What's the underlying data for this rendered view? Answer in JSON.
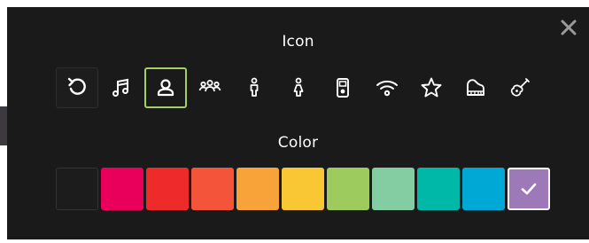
{
  "dialog": {
    "icon_title": "Icon",
    "color_title": "Color",
    "close_icon": "close-icon"
  },
  "icons": [
    {
      "name": "reset-icon",
      "state": "reset"
    },
    {
      "name": "music-note-icon",
      "state": "normal"
    },
    {
      "name": "person-icon",
      "state": "selected"
    },
    {
      "name": "group-icon",
      "state": "normal"
    },
    {
      "name": "man-icon",
      "state": "normal"
    },
    {
      "name": "woman-icon",
      "state": "normal"
    },
    {
      "name": "ipod-icon",
      "state": "normal"
    },
    {
      "name": "wifi-icon",
      "state": "normal"
    },
    {
      "name": "star-icon",
      "state": "normal"
    },
    {
      "name": "piano-icon",
      "state": "normal"
    },
    {
      "name": "guitar-icon",
      "state": "normal"
    }
  ],
  "colors": [
    {
      "name": "color-none",
      "hex": "#1c1c1c",
      "selected": false
    },
    {
      "name": "color-pink",
      "hex": "#e8005b",
      "selected": false
    },
    {
      "name": "color-red",
      "hex": "#ef2a2a",
      "selected": false
    },
    {
      "name": "color-orange-red",
      "hex": "#f4553a",
      "selected": false
    },
    {
      "name": "color-orange",
      "hex": "#f8a23a",
      "selected": false
    },
    {
      "name": "color-yellow",
      "hex": "#f9c733",
      "selected": false
    },
    {
      "name": "color-green",
      "hex": "#9ecb5d",
      "selected": false
    },
    {
      "name": "color-mint",
      "hex": "#84cca2",
      "selected": false
    },
    {
      "name": "color-teal",
      "hex": "#00b8a7",
      "selected": false
    },
    {
      "name": "color-blue",
      "hex": "#00a8d6",
      "selected": false
    },
    {
      "name": "color-purple",
      "hex": "#9e79b8",
      "selected": true
    }
  ],
  "accent": {
    "selected_icon_border": "#a3d061",
    "selected_color_border": "#ffffff"
  }
}
